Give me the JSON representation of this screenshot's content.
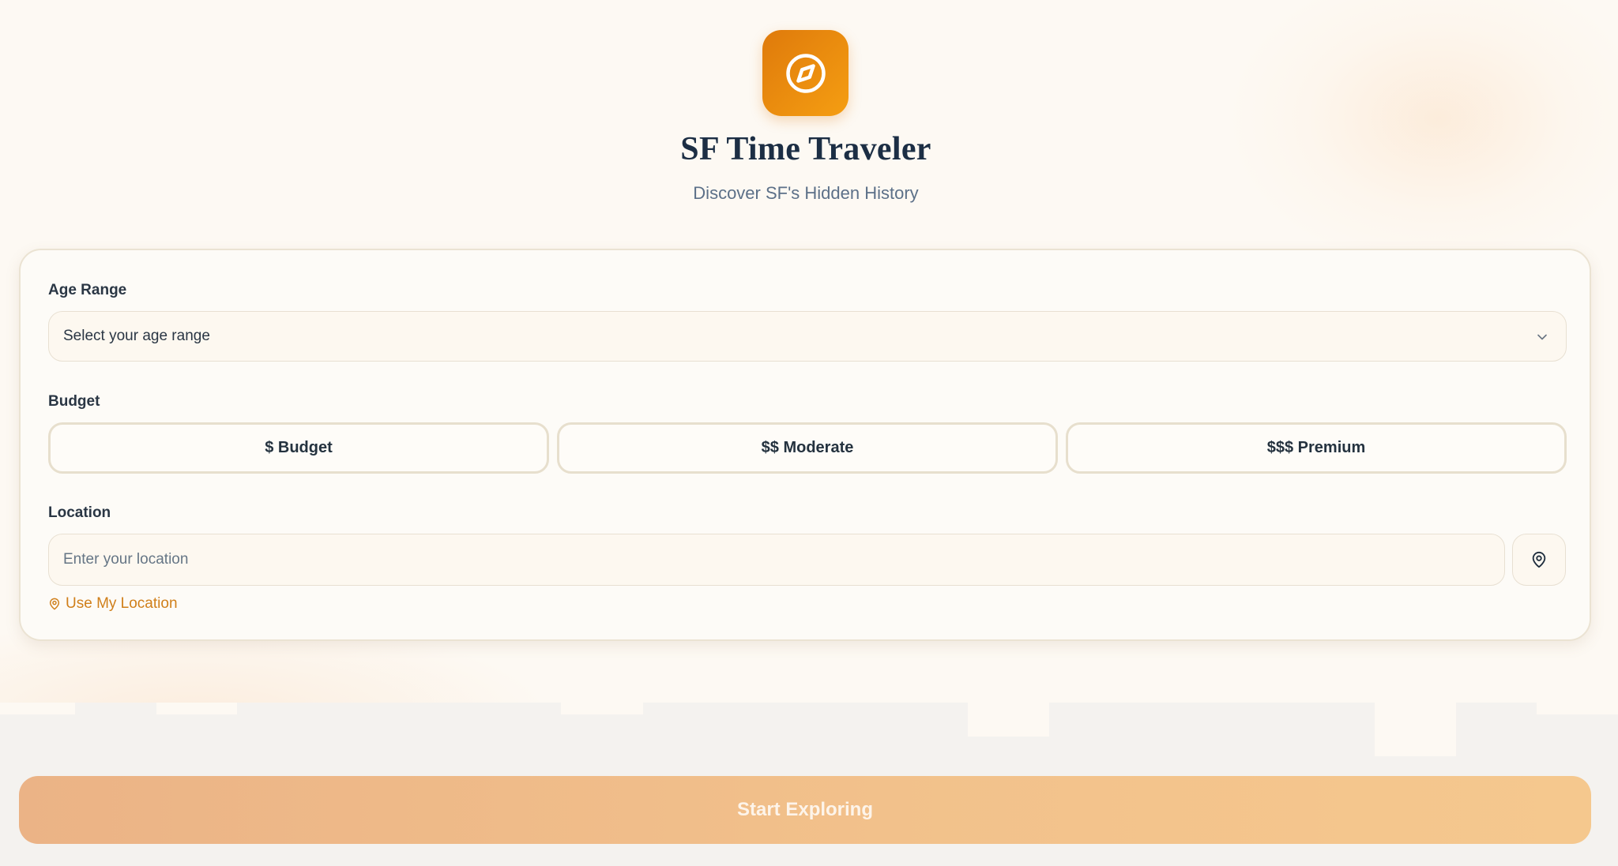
{
  "app": {
    "title": "SF Time Traveler",
    "subtitle": "Discover SF's Hidden History",
    "logo_icon": "compass-icon"
  },
  "form": {
    "age_range": {
      "label": "Age Range",
      "selected": "Select your age range"
    },
    "budget": {
      "label": "Budget",
      "options": [
        "$ Budget",
        "$$ Moderate",
        "$$$ Premium"
      ]
    },
    "location": {
      "label": "Location",
      "placeholder": "Enter your location",
      "pin_icon": "map-pin-icon",
      "use_my_location": "Use My Location"
    }
  },
  "cta": {
    "label": "Start Exploring"
  },
  "colors": {
    "accent": "#f59e12",
    "accent_dark": "#df7a0b",
    "link": "#d07f1a",
    "title": "#1c2e44",
    "cta_start": "#ebb386",
    "cta_end": "#f5c88e"
  }
}
